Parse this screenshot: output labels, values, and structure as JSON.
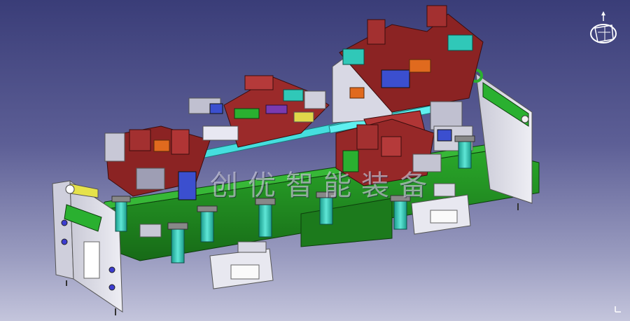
{
  "viewport": {
    "background_top": "#3a3d78",
    "background_bottom": "#c4c5dc"
  },
  "model": {
    "frame_color": "#1f8a1f",
    "plate_color": "#dcdce6",
    "clamp_color": "#9b2a2a",
    "cylinder_color": "#29c4b0",
    "rail_color": "#40d8d8",
    "accent_colors": [
      "#e06a1e",
      "#3b4fcf",
      "#e0d84a",
      "#7a3ab0"
    ]
  },
  "watermark": {
    "text": "创优智能装备"
  },
  "compass": {
    "icon": "compass-axis-icon"
  }
}
